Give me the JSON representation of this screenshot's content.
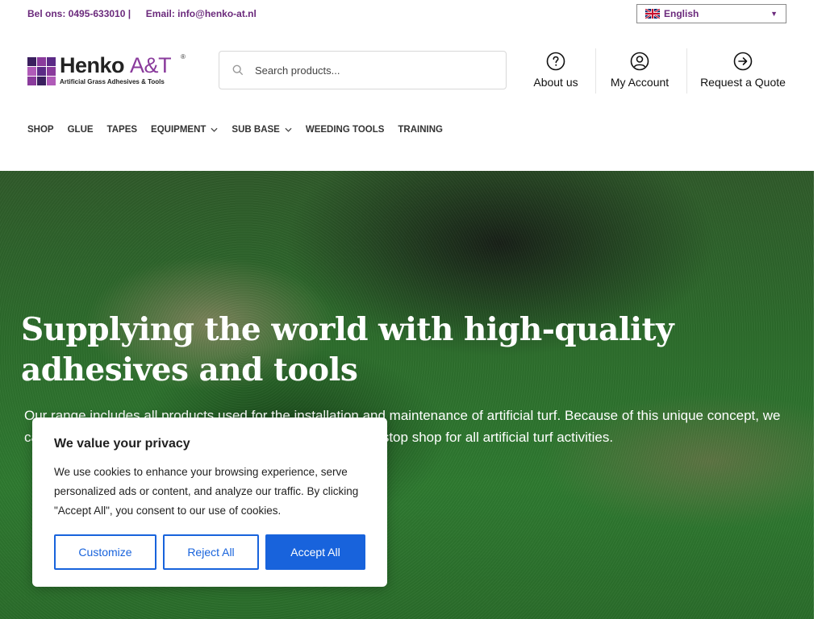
{
  "topbar": {
    "phone": "Bel ons: 0495-633010 |",
    "email": "Email: info@henko-at.nl"
  },
  "language": {
    "selected": "English",
    "flag_icon": "uk-flag-icon"
  },
  "logo": {
    "name": "Henko",
    "name_accent": "A&T",
    "registered": "®",
    "tagline": "Artificial Grass Adhesives & Tools",
    "colors": [
      "#5b2a86",
      "#8a3b9c",
      "#b05bb8",
      "#3a1f5e"
    ]
  },
  "search": {
    "placeholder": "Search products..."
  },
  "header_links": [
    {
      "label": "About us",
      "icon": "question-circle-icon"
    },
    {
      "label": "My Account",
      "icon": "user-circle-icon"
    },
    {
      "label": "Request a Quote",
      "icon": "arrow-right-circle-icon"
    }
  ],
  "nav": {
    "items": [
      {
        "label": "SHOP"
      },
      {
        "label": "GLUE"
      },
      {
        "label": "TAPES"
      },
      {
        "label": "EQUIPMENT",
        "dropdown": true
      },
      {
        "label": "SUB BASE",
        "dropdown": true
      },
      {
        "label": "WEEDING TOOLS"
      },
      {
        "label": "TRAINING"
      }
    ]
  },
  "hero": {
    "title": "Supplying the world with high-quality adhesives and tools",
    "text_line1": "Our range includes all products used for the installation and maintenance of artificial turf. Because of this unique concept, we",
    "text_line2": "can offer our customers a complete range and are the one-stop shop for all artificial turf activities."
  },
  "cookie": {
    "title": "We value your privacy",
    "body": "We use cookies to enhance your browsing experience, serve personalized ads or content, and analyze our traffic. By clicking \"Accept All\", you consent to our use of cookies.",
    "customize": "Customize",
    "reject": "Reject All",
    "accept": "Accept All"
  },
  "colors": {
    "brand_purple": "#6b2a7c",
    "accent_blue": "#1863dc"
  }
}
